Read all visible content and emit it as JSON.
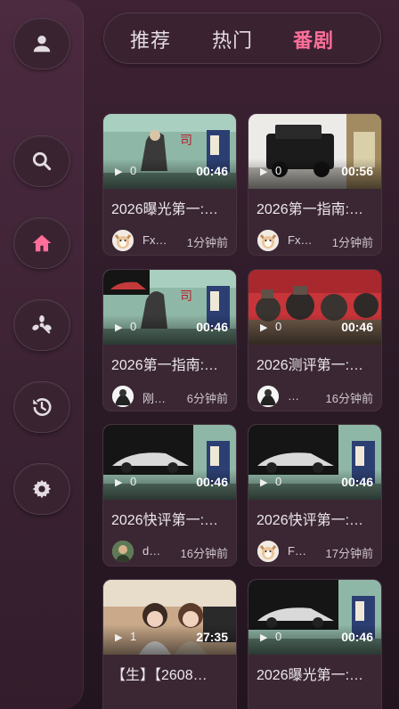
{
  "sidebar": {
    "items": [
      {
        "icon": "user-icon",
        "label": "profile"
      },
      {
        "icon": "search-icon",
        "label": "search"
      },
      {
        "icon": "home-icon",
        "label": "home",
        "active": true
      },
      {
        "icon": "pinwheel-icon",
        "label": "discover"
      },
      {
        "icon": "history-icon",
        "label": "history"
      },
      {
        "icon": "gear-icon",
        "label": "settings"
      }
    ],
    "active_color": "#ff6f9a",
    "icon_color": "#e2dce0"
  },
  "tabs": [
    {
      "label": "推荐",
      "active": false
    },
    {
      "label": "热门",
      "active": false
    },
    {
      "label": "番剧",
      "active": true
    }
  ],
  "videos": [
    {
      "title": "2026曝光第一:…",
      "views": "0",
      "duration": "00:46",
      "author": "Fx…",
      "time": "1分钟前",
      "thumb": "ink-painting",
      "avatar": "cat"
    },
    {
      "title": "2026第一指南:…",
      "views": "0",
      "duration": "00:56",
      "author": "Fx…",
      "time": "1分钟前",
      "thumb": "black-suv",
      "avatar": "cat"
    },
    {
      "title": "2026第一指南:…",
      "views": "0",
      "duration": "00:46",
      "author": "刚…",
      "time": "6分钟前",
      "thumb": "ink-painting-car",
      "avatar": "sketch"
    },
    {
      "title": "2026测评第一:…",
      "views": "0",
      "duration": "00:46",
      "author": "…",
      "time": "16分钟前",
      "thumb": "cartoon-crowd",
      "avatar": "sketch"
    },
    {
      "title": "2026快评第一:…",
      "views": "0",
      "duration": "00:46",
      "author": "d…",
      "time": "16分钟前",
      "thumb": "sports-car",
      "avatar": "portrait"
    },
    {
      "title": "2026快评第一:…",
      "views": "0",
      "duration": "00:46",
      "author": "F…",
      "time": "17分钟前",
      "thumb": "sports-car",
      "avatar": "cat"
    },
    {
      "title": "【生】【2608…",
      "views": "1",
      "duration": "27:35",
      "author": "",
      "time": "",
      "thumb": "two-women",
      "avatar": ""
    },
    {
      "title": "2026曝光第一:…",
      "views": "0",
      "duration": "00:46",
      "author": "",
      "time": "",
      "thumb": "sports-car",
      "avatar": ""
    }
  ]
}
